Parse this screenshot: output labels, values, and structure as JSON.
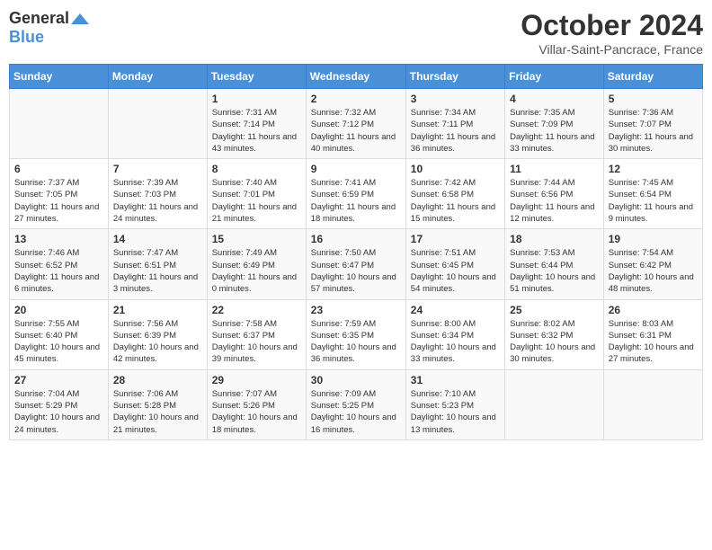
{
  "logo": {
    "general": "General",
    "blue": "Blue"
  },
  "title": "October 2024",
  "location": "Villar-Saint-Pancrace, France",
  "days_of_week": [
    "Sunday",
    "Monday",
    "Tuesday",
    "Wednesday",
    "Thursday",
    "Friday",
    "Saturday"
  ],
  "weeks": [
    [
      {
        "day": "",
        "sunrise": "",
        "sunset": "",
        "daylight": ""
      },
      {
        "day": "",
        "sunrise": "",
        "sunset": "",
        "daylight": ""
      },
      {
        "day": "1",
        "sunrise": "Sunrise: 7:31 AM",
        "sunset": "Sunset: 7:14 PM",
        "daylight": "Daylight: 11 hours and 43 minutes."
      },
      {
        "day": "2",
        "sunrise": "Sunrise: 7:32 AM",
        "sunset": "Sunset: 7:12 PM",
        "daylight": "Daylight: 11 hours and 40 minutes."
      },
      {
        "day": "3",
        "sunrise": "Sunrise: 7:34 AM",
        "sunset": "Sunset: 7:11 PM",
        "daylight": "Daylight: 11 hours and 36 minutes."
      },
      {
        "day": "4",
        "sunrise": "Sunrise: 7:35 AM",
        "sunset": "Sunset: 7:09 PM",
        "daylight": "Daylight: 11 hours and 33 minutes."
      },
      {
        "day": "5",
        "sunrise": "Sunrise: 7:36 AM",
        "sunset": "Sunset: 7:07 PM",
        "daylight": "Daylight: 11 hours and 30 minutes."
      }
    ],
    [
      {
        "day": "6",
        "sunrise": "Sunrise: 7:37 AM",
        "sunset": "Sunset: 7:05 PM",
        "daylight": "Daylight: 11 hours and 27 minutes."
      },
      {
        "day": "7",
        "sunrise": "Sunrise: 7:39 AM",
        "sunset": "Sunset: 7:03 PM",
        "daylight": "Daylight: 11 hours and 24 minutes."
      },
      {
        "day": "8",
        "sunrise": "Sunrise: 7:40 AM",
        "sunset": "Sunset: 7:01 PM",
        "daylight": "Daylight: 11 hours and 21 minutes."
      },
      {
        "day": "9",
        "sunrise": "Sunrise: 7:41 AM",
        "sunset": "Sunset: 6:59 PM",
        "daylight": "Daylight: 11 hours and 18 minutes."
      },
      {
        "day": "10",
        "sunrise": "Sunrise: 7:42 AM",
        "sunset": "Sunset: 6:58 PM",
        "daylight": "Daylight: 11 hours and 15 minutes."
      },
      {
        "day": "11",
        "sunrise": "Sunrise: 7:44 AM",
        "sunset": "Sunset: 6:56 PM",
        "daylight": "Daylight: 11 hours and 12 minutes."
      },
      {
        "day": "12",
        "sunrise": "Sunrise: 7:45 AM",
        "sunset": "Sunset: 6:54 PM",
        "daylight": "Daylight: 11 hours and 9 minutes."
      }
    ],
    [
      {
        "day": "13",
        "sunrise": "Sunrise: 7:46 AM",
        "sunset": "Sunset: 6:52 PM",
        "daylight": "Daylight: 11 hours and 6 minutes."
      },
      {
        "day": "14",
        "sunrise": "Sunrise: 7:47 AM",
        "sunset": "Sunset: 6:51 PM",
        "daylight": "Daylight: 11 hours and 3 minutes."
      },
      {
        "day": "15",
        "sunrise": "Sunrise: 7:49 AM",
        "sunset": "Sunset: 6:49 PM",
        "daylight": "Daylight: 11 hours and 0 minutes."
      },
      {
        "day": "16",
        "sunrise": "Sunrise: 7:50 AM",
        "sunset": "Sunset: 6:47 PM",
        "daylight": "Daylight: 10 hours and 57 minutes."
      },
      {
        "day": "17",
        "sunrise": "Sunrise: 7:51 AM",
        "sunset": "Sunset: 6:45 PM",
        "daylight": "Daylight: 10 hours and 54 minutes."
      },
      {
        "day": "18",
        "sunrise": "Sunrise: 7:53 AM",
        "sunset": "Sunset: 6:44 PM",
        "daylight": "Daylight: 10 hours and 51 minutes."
      },
      {
        "day": "19",
        "sunrise": "Sunrise: 7:54 AM",
        "sunset": "Sunset: 6:42 PM",
        "daylight": "Daylight: 10 hours and 48 minutes."
      }
    ],
    [
      {
        "day": "20",
        "sunrise": "Sunrise: 7:55 AM",
        "sunset": "Sunset: 6:40 PM",
        "daylight": "Daylight: 10 hours and 45 minutes."
      },
      {
        "day": "21",
        "sunrise": "Sunrise: 7:56 AM",
        "sunset": "Sunset: 6:39 PM",
        "daylight": "Daylight: 10 hours and 42 minutes."
      },
      {
        "day": "22",
        "sunrise": "Sunrise: 7:58 AM",
        "sunset": "Sunset: 6:37 PM",
        "daylight": "Daylight: 10 hours and 39 minutes."
      },
      {
        "day": "23",
        "sunrise": "Sunrise: 7:59 AM",
        "sunset": "Sunset: 6:35 PM",
        "daylight": "Daylight: 10 hours and 36 minutes."
      },
      {
        "day": "24",
        "sunrise": "Sunrise: 8:00 AM",
        "sunset": "Sunset: 6:34 PM",
        "daylight": "Daylight: 10 hours and 33 minutes."
      },
      {
        "day": "25",
        "sunrise": "Sunrise: 8:02 AM",
        "sunset": "Sunset: 6:32 PM",
        "daylight": "Daylight: 10 hours and 30 minutes."
      },
      {
        "day": "26",
        "sunrise": "Sunrise: 8:03 AM",
        "sunset": "Sunset: 6:31 PM",
        "daylight": "Daylight: 10 hours and 27 minutes."
      }
    ],
    [
      {
        "day": "27",
        "sunrise": "Sunrise: 7:04 AM",
        "sunset": "Sunset: 5:29 PM",
        "daylight": "Daylight: 10 hours and 24 minutes."
      },
      {
        "day": "28",
        "sunrise": "Sunrise: 7:06 AM",
        "sunset": "Sunset: 5:28 PM",
        "daylight": "Daylight: 10 hours and 21 minutes."
      },
      {
        "day": "29",
        "sunrise": "Sunrise: 7:07 AM",
        "sunset": "Sunset: 5:26 PM",
        "daylight": "Daylight: 10 hours and 18 minutes."
      },
      {
        "day": "30",
        "sunrise": "Sunrise: 7:09 AM",
        "sunset": "Sunset: 5:25 PM",
        "daylight": "Daylight: 10 hours and 16 minutes."
      },
      {
        "day": "31",
        "sunrise": "Sunrise: 7:10 AM",
        "sunset": "Sunset: 5:23 PM",
        "daylight": "Daylight: 10 hours and 13 minutes."
      },
      {
        "day": "",
        "sunrise": "",
        "sunset": "",
        "daylight": ""
      },
      {
        "day": "",
        "sunrise": "",
        "sunset": "",
        "daylight": ""
      }
    ]
  ]
}
